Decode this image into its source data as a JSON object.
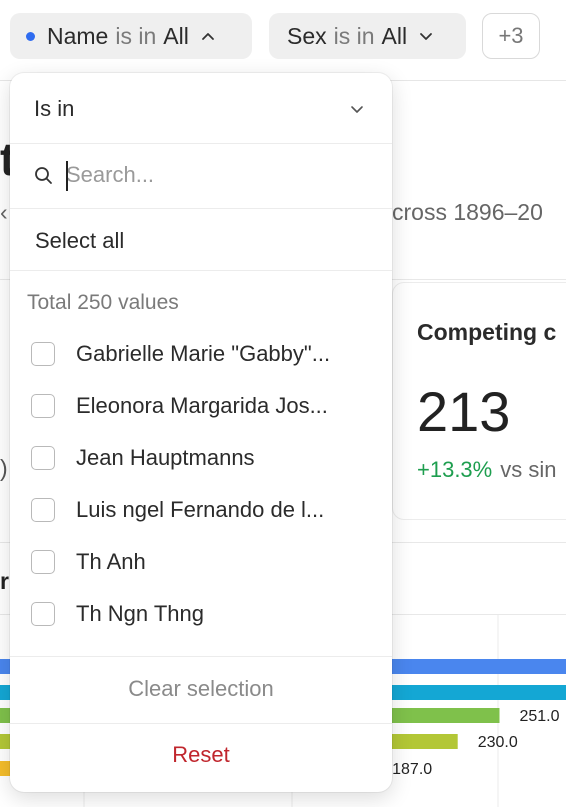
{
  "filters": [
    {
      "field": "Name",
      "operator": "is in",
      "value": "All",
      "indicator_color": "#2f6cf0",
      "expanded": true
    },
    {
      "field": "Sex",
      "operator": "is in",
      "value": "All",
      "expanded": false
    }
  ],
  "more_filters_label": "+3",
  "page": {
    "title_fragment": "t",
    "subtitle_left_fragment": "‹",
    "subtitle_fragment": "cross 1896–20",
    "kpi": {
      "title": "Competing c",
      "value": "213",
      "delta": "+13.3%",
      "delta_suffix": "vs sin",
      "delta_color": "#1e9e4f"
    },
    "left_fragment_1": ")",
    "left_fragment_2": "r"
  },
  "dropdown": {
    "operator_label": "Is in",
    "search_placeholder": "Search...",
    "select_all_label": "Select all",
    "total_label": "Total 250 values",
    "options": [
      "Gabrielle Marie \"Gabby\"...",
      "Eleonora Margarida Jos...",
      "Jean Hauptmanns",
      "Luis ngel Fernando de l...",
      "Th Anh",
      "Th Ngn Thng"
    ],
    "clear_label": "Clear selection",
    "reset_label": "Reset"
  },
  "chart_data": {
    "type": "bar",
    "orientation": "horizontal",
    "partially_visible": true,
    "bars": [
      {
        "value": null,
        "color": "#4a86ee"
      },
      {
        "value": null,
        "color": "#14a7d4"
      },
      {
        "value": 251.0,
        "label": "251.0",
        "color": "#7fc14b"
      },
      {
        "value": 230.0,
        "label": "230.0",
        "color": "#b3c736"
      },
      {
        "value": 187.0,
        "label": "187.0",
        "color": "#f4bd2b"
      }
    ]
  }
}
